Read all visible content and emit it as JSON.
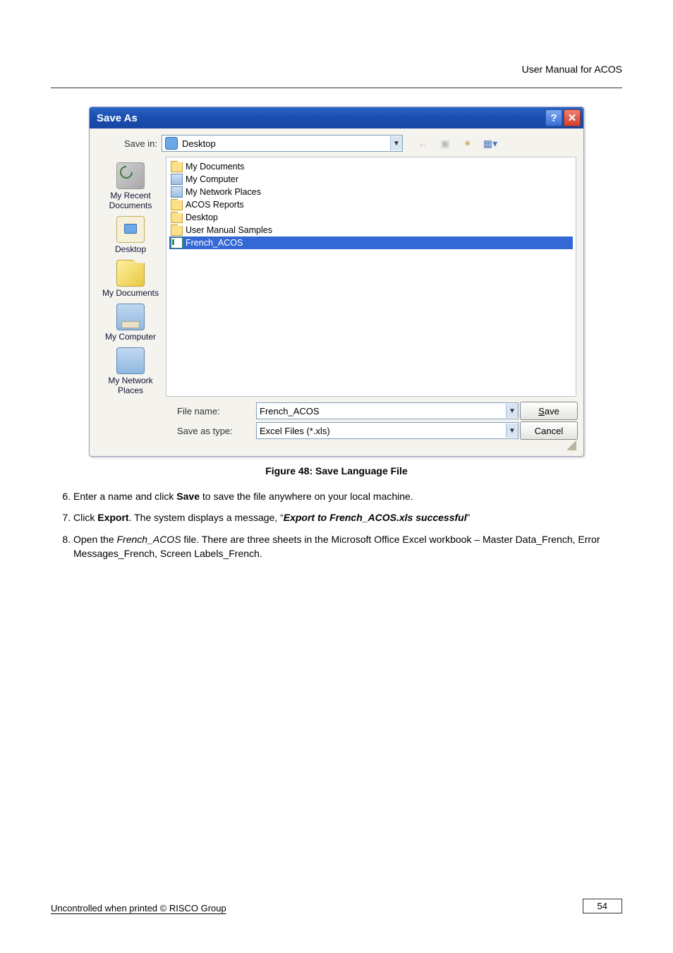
{
  "header": {
    "doc_title": "User Manual for ACOS"
  },
  "dialog": {
    "title": "Save As",
    "savein_label": "Save in:",
    "savein_value": "Desktop",
    "places": [
      {
        "label": "My Recent\nDocuments"
      },
      {
        "label": "Desktop"
      },
      {
        "label": "My Documents"
      },
      {
        "label": "My Computer"
      },
      {
        "label": "My Network\nPlaces"
      }
    ],
    "file_list": [
      {
        "label": "My Documents",
        "icon": "sysfolder"
      },
      {
        "label": "My Computer",
        "icon": "computer"
      },
      {
        "label": "My Network Places",
        "icon": "network"
      },
      {
        "label": "ACOS Reports",
        "icon": "folder"
      },
      {
        "label": "Desktop",
        "icon": "folder"
      },
      {
        "label": "User Manual Samples",
        "icon": "folder"
      },
      {
        "label": "French_ACOS",
        "icon": "excelfile",
        "selected": true
      }
    ],
    "filename_label": "File name:",
    "filename_value": "French_ACOS",
    "savetype_label": "Save as type:",
    "savetype_value": "Excel Files (*.xls)",
    "save_btn": "Save",
    "cancel_btn": "Cancel"
  },
  "figure_caption": "Figure 48: Save Language File",
  "steps": {
    "start": 6,
    "items": [
      {
        "n": 6,
        "parts": [
          {
            "t": "Enter a name and click "
          },
          {
            "t": "Save",
            "style": "bold"
          },
          {
            "t": " to save the file anywhere on your local machine."
          }
        ]
      },
      {
        "n": 7,
        "parts": [
          {
            "t": "Click "
          },
          {
            "t": "Export",
            "style": "bold"
          },
          {
            "t": ". The system displays a message, “"
          },
          {
            "t": "Export to French_ACOS.xls successful",
            "style": "bolditalic"
          },
          {
            "t": "”"
          }
        ]
      },
      {
        "n": 8,
        "parts": [
          {
            "t": "Open the "
          },
          {
            "t": "French_ACOS",
            "style": "italic"
          },
          {
            "t": " file. There are three sheets in the Microsoft Office Excel workbook – Master Data_French, Error Messages_French, Screen Labels_French."
          }
        ]
      }
    ]
  },
  "footer": {
    "left": "Uncontrolled when printed © RISCO Group",
    "page": "54"
  }
}
